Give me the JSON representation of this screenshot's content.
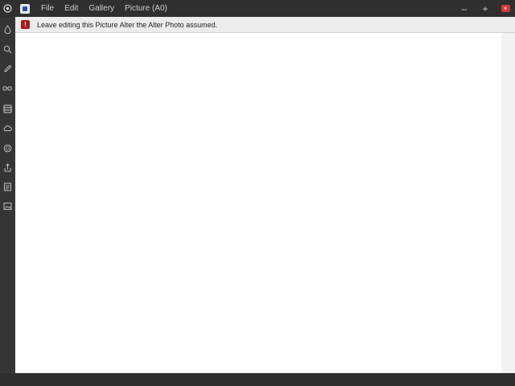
{
  "titlebar": {
    "menu": [
      {
        "label": "File"
      },
      {
        "label": "Edit"
      },
      {
        "label": "Gallery"
      },
      {
        "label": "Picture (A0)"
      }
    ],
    "minimize_label": "–",
    "maximize_label": "+",
    "close_label": "×"
  },
  "notice": {
    "icon_glyph": "!",
    "text": "Leave editing this Picture Alter the Alter Photo assumed."
  },
  "sidebar": {
    "tools": [
      {
        "icon": "drop-icon"
      },
      {
        "icon": "magnifier-icon"
      },
      {
        "icon": "pencil-icon"
      },
      {
        "icon": "glasses-icon"
      },
      {
        "icon": "layers-icon"
      },
      {
        "icon": "cloud-icon"
      },
      {
        "icon": "circle-icon"
      },
      {
        "icon": "share-icon"
      },
      {
        "icon": "document-icon"
      },
      {
        "icon": "image-icon"
      }
    ]
  },
  "colors": {
    "titlebar": "#2f2f30",
    "sidebar": "#353535",
    "notice_bg": "#ececec",
    "notice_icon": "#a61c1c",
    "close": "#d33a3a",
    "canvas": "#ffffff"
  }
}
